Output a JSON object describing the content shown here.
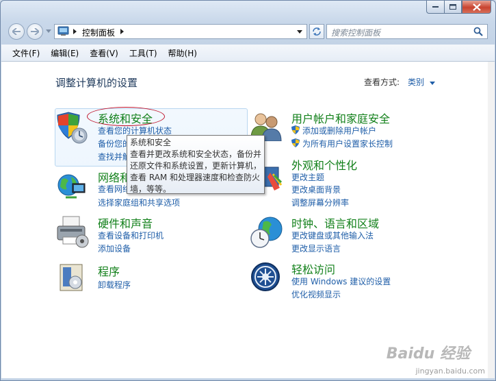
{
  "toolbar": {
    "address_path": "控制面板",
    "search_placeholder": "搜索控制面板"
  },
  "menu": [
    "文件(F)",
    "编辑(E)",
    "查看(V)",
    "工具(T)",
    "帮助(H)"
  ],
  "main": {
    "heading": "调整计算机的设置",
    "view_by_label": "查看方式:",
    "view_by_value": "类别"
  },
  "categories": {
    "system_security": {
      "title": "系统和安全",
      "links": [
        "查看您的计算机状态",
        "备份您的",
        "查找并解"
      ]
    },
    "network": {
      "title": "网络和",
      "links": [
        "查看网络",
        "选择家庭组和共享选项"
      ]
    },
    "hardware": {
      "title": "硬件和声音",
      "links": [
        "查看设备和打印机",
        "添加设备"
      ]
    },
    "programs": {
      "title": "程序",
      "links": [
        "卸载程序"
      ]
    },
    "user_accounts": {
      "title": "用户帐户和家庭安全",
      "links": [
        "添加或删除用户帐户",
        "为所有用户设置家长控制"
      ]
    },
    "appearance": {
      "title": "外观和个性化",
      "links": [
        "更改主题",
        "更改桌面背景",
        "调整屏幕分辨率"
      ]
    },
    "clock": {
      "title": "时钟、语言和区域",
      "links": [
        "更改键盘或其他输入法",
        "更改显示语言"
      ]
    },
    "ease": {
      "title": "轻松访问",
      "links": [
        "使用 Windows 建议的设置",
        "优化视频显示"
      ]
    }
  },
  "tooltip": {
    "title": "系统和安全",
    "lines": [
      "查看并更改系统和安全状态，备份并",
      "还原文件和系统设置，更新计算机，",
      "查看 RAM 和处理器速度和检查防火",
      "墙，等等。"
    ]
  },
  "watermark": {
    "logo": "Baidu 经验",
    "url": "jingyan.baidu.com"
  }
}
